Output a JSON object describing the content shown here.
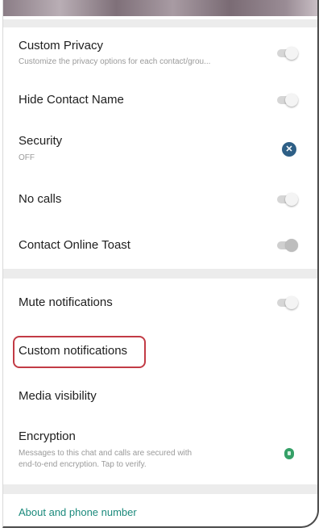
{
  "settings": {
    "custom_privacy": {
      "title": "Custom Privacy",
      "subtitle": "Customize the privacy options for each contact/grou...",
      "toggle": "off"
    },
    "hide_contact_name": {
      "title": "Hide Contact Name",
      "toggle": "off"
    },
    "security": {
      "title": "Security",
      "subtitle": "OFF",
      "icon": "close-circle-icon",
      "icon_glyph": "✕",
      "icon_color": "#2e5f86"
    },
    "no_calls": {
      "title": "No calls",
      "toggle": "off"
    },
    "contact_online_toast": {
      "title": "Contact Online Toast",
      "toggle": "disabled"
    },
    "mute_notifications": {
      "title": "Mute notifications",
      "toggle": "off"
    },
    "custom_notifications": {
      "title": "Custom notifications",
      "highlight_color": "#c23b45"
    },
    "media_visibility": {
      "title": "Media visibility"
    },
    "encryption": {
      "title": "Encryption",
      "subtitle_line1": "Messages to this chat and calls are secured with",
      "subtitle_line2": "end-to-end encryption. Tap to verify.",
      "icon": "lock-icon",
      "icon_color": "#35a067"
    },
    "about": {
      "label": "About and phone number",
      "color": "#1b8a7c"
    }
  }
}
